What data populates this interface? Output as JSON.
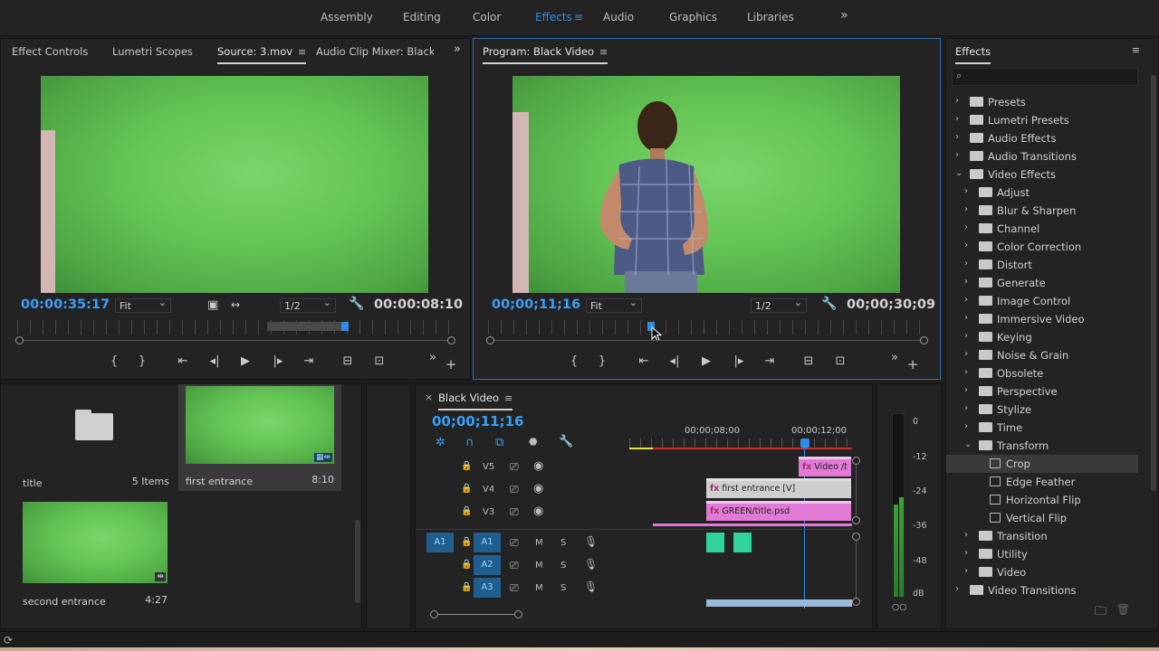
{
  "workspaces": {
    "items": [
      "Assembly",
      "Editing",
      "Color",
      "Effects",
      "Audio",
      "Graphics",
      "Libraries"
    ],
    "active": "Effects",
    "more": "»"
  },
  "source_panel": {
    "tabs": [
      "Effect Controls",
      "Lumetri Scopes",
      "Source: 3.mov",
      "Audio Clip Mixer: Black Vid"
    ],
    "active_tab": "Source: 3.mov",
    "timecode_current": "00:00:35:17",
    "fit": "Fit",
    "resolution": "1/2",
    "timecode_duration": "00:00:08:10"
  },
  "program_panel": {
    "title": "Program: Black Video",
    "timecode_current": "00;00;11;16",
    "fit": "Fit",
    "resolution": "1/2",
    "timecode_duration": "00;00;30;09"
  },
  "project_panel": {
    "items": [
      {
        "name": "title",
        "meta": "5 Items",
        "type": "bin"
      },
      {
        "name": "first entrance",
        "meta": "8:10",
        "type": "clip"
      },
      {
        "name": "second entrance",
        "meta": "4:27",
        "type": "clip"
      }
    ]
  },
  "timeline": {
    "sequence": "Black Video",
    "timecode": "00;00;11;16",
    "ruler_labels": [
      "00;00;08;00",
      "00;00;12;00"
    ],
    "video_tracks": [
      "V5",
      "V4",
      "V3"
    ],
    "audio_tracks": [
      "A1",
      "A2",
      "A3"
    ],
    "source_patch": "A1",
    "clips": [
      {
        "track": "V5",
        "label": "Video /t"
      },
      {
        "track": "V4",
        "label": "first entrance [V]"
      },
      {
        "track": "V3",
        "label": "GREEN/title.psd"
      }
    ],
    "track_buttons": {
      "mute": "M",
      "solo": "S"
    }
  },
  "meters": {
    "labels": [
      "0",
      "-12",
      "-24",
      "-36",
      "-48",
      "dB"
    ],
    "footer": "○○"
  },
  "effects_panel": {
    "title": "Effects",
    "search_placeholder": "",
    "tree": [
      {
        "label": "Presets",
        "level": 0,
        "open": false,
        "kind": "special"
      },
      {
        "label": "Lumetri Presets",
        "level": 0,
        "open": false,
        "kind": "special"
      },
      {
        "label": "Audio Effects",
        "level": 0,
        "open": false,
        "kind": "folder"
      },
      {
        "label": "Audio Transitions",
        "level": 0,
        "open": false,
        "kind": "folder"
      },
      {
        "label": "Video Effects",
        "level": 0,
        "open": true,
        "kind": "folder"
      },
      {
        "label": "Adjust",
        "level": 1,
        "open": false,
        "kind": "folder"
      },
      {
        "label": "Blur & Sharpen",
        "level": 1,
        "open": false,
        "kind": "folder"
      },
      {
        "label": "Channel",
        "level": 1,
        "open": false,
        "kind": "folder"
      },
      {
        "label": "Color Correction",
        "level": 1,
        "open": false,
        "kind": "folder"
      },
      {
        "label": "Distort",
        "level": 1,
        "open": false,
        "kind": "folder"
      },
      {
        "label": "Generate",
        "level": 1,
        "open": false,
        "kind": "folder"
      },
      {
        "label": "Image Control",
        "level": 1,
        "open": false,
        "kind": "folder"
      },
      {
        "label": "Immersive Video",
        "level": 1,
        "open": false,
        "kind": "folder"
      },
      {
        "label": "Keying",
        "level": 1,
        "open": false,
        "kind": "folder"
      },
      {
        "label": "Noise & Grain",
        "level": 1,
        "open": false,
        "kind": "folder"
      },
      {
        "label": "Obsolete",
        "level": 1,
        "open": false,
        "kind": "folder"
      },
      {
        "label": "Perspective",
        "level": 1,
        "open": false,
        "kind": "folder"
      },
      {
        "label": "Stylize",
        "level": 1,
        "open": false,
        "kind": "folder"
      },
      {
        "label": "Time",
        "level": 1,
        "open": false,
        "kind": "folder"
      },
      {
        "label": "Transform",
        "level": 1,
        "open": true,
        "kind": "folder"
      },
      {
        "label": "Crop",
        "level": 2,
        "kind": "effect",
        "selected": true
      },
      {
        "label": "Edge Feather",
        "level": 2,
        "kind": "effect"
      },
      {
        "label": "Horizontal Flip",
        "level": 2,
        "kind": "effect"
      },
      {
        "label": "Vertical Flip",
        "level": 2,
        "kind": "effect"
      },
      {
        "label": "Transition",
        "level": 1,
        "open": false,
        "kind": "folder"
      },
      {
        "label": "Utility",
        "level": 1,
        "open": false,
        "kind": "folder"
      },
      {
        "label": "Video",
        "level": 1,
        "open": false,
        "kind": "folder"
      },
      {
        "label": "Video Transitions",
        "level": 0,
        "open": false,
        "kind": "folder"
      }
    ]
  },
  "colors": {
    "accent": "#2d8ceb",
    "clip_pink": "#e07ad4",
    "audio_clip": "#2fd39a",
    "panel": "#232323"
  }
}
